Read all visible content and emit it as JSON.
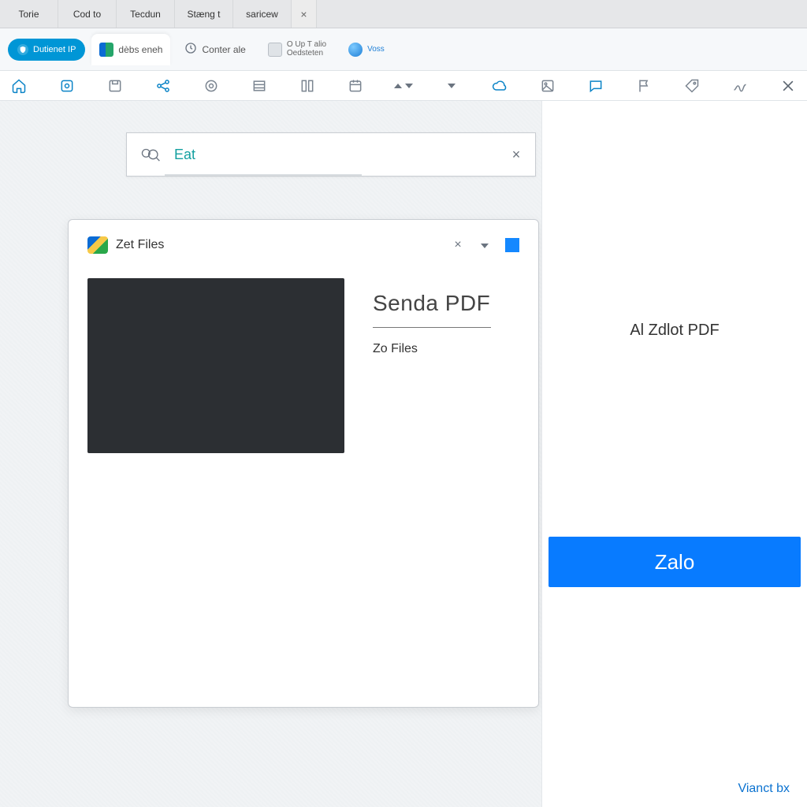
{
  "window_tabs": [
    "Torie",
    "Cod to",
    "Tecdun",
    "Stæng t",
    "saricew"
  ],
  "app_row": {
    "pill_label": "Dutienet IP",
    "tabs": [
      {
        "label": "dèbs eneh"
      },
      {
        "label": "Conter ale"
      },
      {
        "label_top": "O Up T alio",
        "label_bot": "Oedsteten"
      },
      {
        "label": "Voss"
      }
    ]
  },
  "search": {
    "value": "Eat"
  },
  "card": {
    "title": "Zet Files",
    "headline": "Senda PDF",
    "subline": "Zo Files"
  },
  "right_panel": {
    "title": "Al Zdlot PDF",
    "button": "Zalo",
    "footer": "Vianct bx"
  }
}
